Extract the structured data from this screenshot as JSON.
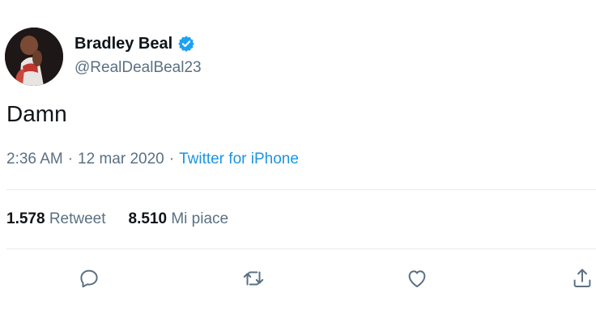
{
  "author": {
    "display_name": "Bradley Beal",
    "handle": "@RealDealBeal23",
    "verified": true
  },
  "tweet": {
    "text": "Damn",
    "time": "2:36 AM",
    "date": "12 mar 2020",
    "separator": "·",
    "source": "Twitter for iPhone"
  },
  "stats": {
    "retweets_count": "1.578",
    "retweets_label": "Retweet",
    "likes_count": "8.510",
    "likes_label": "Mi piace"
  },
  "actions": {
    "icons": [
      "reply-icon",
      "retweet-icon",
      "like-icon",
      "share-icon"
    ]
  },
  "colors": {
    "text": "#0f1419",
    "secondary": "#5b7083",
    "link": "#1b95e0",
    "verified": "#1da1f2",
    "divider": "#e6ecf0"
  }
}
